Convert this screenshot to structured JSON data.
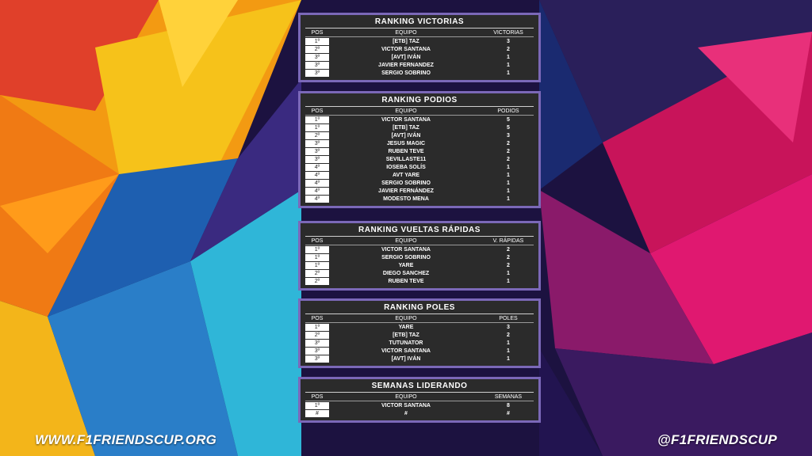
{
  "panels": [
    {
      "title": "RANKING VICTORIAS",
      "headers": [
        "POS",
        "EQUIPO",
        "VICTORIAS"
      ],
      "rows": [
        [
          "1º",
          "[ETB] TAZ",
          "3"
        ],
        [
          "2º",
          "VICTOR SANTANA",
          "2"
        ],
        [
          "3º",
          "[AVT] IVÁN",
          "1"
        ],
        [
          "3º",
          "JAVIER FERNANDEZ",
          "1"
        ],
        [
          "3º",
          "SERGIO SOBRINO",
          "1"
        ]
      ]
    },
    {
      "title": "RANKING PODIOS",
      "headers": [
        "POS",
        "EQUIPO",
        "PODIOS"
      ],
      "rows": [
        [
          "1º",
          "VICTOR SANTANA",
          "5"
        ],
        [
          "1º",
          "[ETB] TAZ",
          "5"
        ],
        [
          "2º",
          "[AVT] IVÁN",
          "3"
        ],
        [
          "3º",
          "JESUS MAGIC",
          "2"
        ],
        [
          "3º",
          "RUBEN TEVE",
          "2"
        ],
        [
          "3º",
          "SEVILLASTE11",
          "2"
        ],
        [
          "4º",
          "IOSEBA SOLÍS",
          "1"
        ],
        [
          "4º",
          "AVT YARE",
          "1"
        ],
        [
          "4º",
          "SERGIO SOBRINO",
          "1"
        ],
        [
          "4º",
          "JAVIER FERNÁNDEZ",
          "1"
        ],
        [
          "4º",
          "MODESTO MENA",
          "1"
        ]
      ]
    },
    {
      "title": "RANKING VUELTAS RÁPIDAS",
      "headers": [
        "POS",
        "EQUIPO",
        "V. RÁPIDAS"
      ],
      "rows": [
        [
          "1º",
          "VICTOR SANTANA",
          "2"
        ],
        [
          "1º",
          "SERGIO SOBRINO",
          "2"
        ],
        [
          "1º",
          "YARE",
          "2"
        ],
        [
          "2º",
          "DIEGO SANCHEZ",
          "1"
        ],
        [
          "2º",
          "RUBEN TEVE",
          "1"
        ]
      ]
    },
    {
      "title": "RANKING POLES",
      "headers": [
        "POS",
        "EQUIPO",
        "POLES"
      ],
      "rows": [
        [
          "1º",
          "YARE",
          "3"
        ],
        [
          "2º",
          "[ETB] TAZ",
          "2"
        ],
        [
          "3º",
          "TUTUNATOR",
          "1"
        ],
        [
          "3º",
          "VICTOR SANTANA",
          "1"
        ],
        [
          "3º",
          "[AVT] IVÁN",
          "1"
        ]
      ]
    },
    {
      "title": "SEMANAS LIDERANDO",
      "headers": [
        "POS",
        "EQUIPO",
        "SEMANAS"
      ],
      "rows": [
        [
          "1º",
          "VICTOR SANTANA",
          "8"
        ],
        [
          "#",
          "#",
          "#"
        ]
      ]
    }
  ],
  "footer": {
    "left": "WWW.F1FRIENDSCUP.ORG",
    "right": "@F1FRIENDSCUP"
  },
  "colors": {
    "panel_bg": "#2b2b2b",
    "panel_border": "#7b68b8",
    "text": "#ffffff"
  }
}
